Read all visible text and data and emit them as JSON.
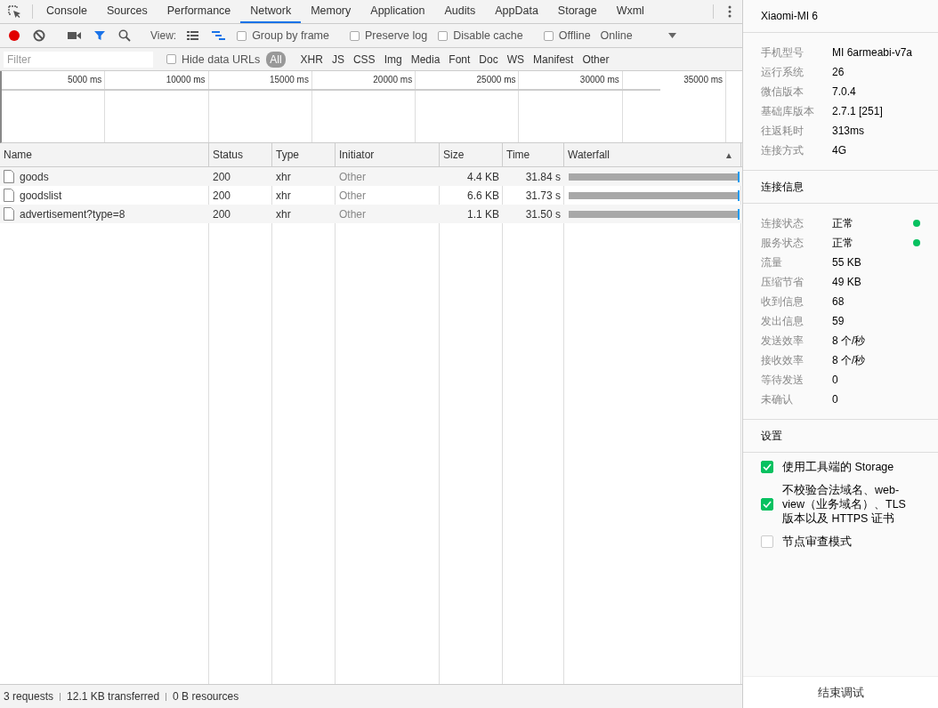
{
  "tabs": [
    {
      "label": "Console",
      "selected": false
    },
    {
      "label": "Sources",
      "selected": false
    },
    {
      "label": "Performance",
      "selected": false
    },
    {
      "label": "Network",
      "selected": true
    },
    {
      "label": "Memory",
      "selected": false
    },
    {
      "label": "Application",
      "selected": false
    },
    {
      "label": "Audits",
      "selected": false
    },
    {
      "label": "AppData",
      "selected": false
    },
    {
      "label": "Storage",
      "selected": false
    },
    {
      "label": "Wxml",
      "selected": false
    }
  ],
  "toolbar": {
    "recording": true,
    "filter_active": true,
    "view_label": "View:",
    "views": [
      {
        "kind": "list",
        "selected": false
      },
      {
        "kind": "waterfall",
        "selected": true
      }
    ],
    "options": [
      {
        "label": "Group by frame",
        "checked": false
      },
      {
        "label": "Preserve log",
        "checked": false
      },
      {
        "label": "Disable cache",
        "checked": false
      },
      {
        "label": "Offline",
        "checked": false
      }
    ],
    "throttling": "Online"
  },
  "filter_bar": {
    "placeholder": "Filter",
    "hide_data_urls": {
      "label": "Hide data URLs",
      "checked": false
    },
    "types": [
      {
        "label": "All",
        "selected": true
      },
      {
        "label": "XHR",
        "selected": false
      },
      {
        "label": "JS",
        "selected": false
      },
      {
        "label": "CSS",
        "selected": false
      },
      {
        "label": "Img",
        "selected": false
      },
      {
        "label": "Media",
        "selected": false
      },
      {
        "label": "Font",
        "selected": false
      },
      {
        "label": "Doc",
        "selected": false
      },
      {
        "label": "WS",
        "selected": false
      },
      {
        "label": "Manifest",
        "selected": false
      },
      {
        "label": "Other",
        "selected": false
      }
    ]
  },
  "overview": {
    "ticks": [
      "5000 ms",
      "10000 ms",
      "15000 ms",
      "20000 ms",
      "25000 ms",
      "30000 ms",
      "35000 ms"
    ]
  },
  "table": {
    "columns": [
      {
        "label": "Name"
      },
      {
        "label": "Status"
      },
      {
        "label": "Type"
      },
      {
        "label": "Initiator"
      },
      {
        "label": "Size"
      },
      {
        "label": "Time"
      },
      {
        "label": "Waterfall",
        "sort_icon": "▲"
      }
    ],
    "rows": [
      {
        "name": "goods",
        "status": "200",
        "type": "xhr",
        "initiator": "Other",
        "size": "4.4 KB",
        "time": "31.84 s"
      },
      {
        "name": "goodslist",
        "status": "200",
        "type": "xhr",
        "initiator": "Other",
        "size": "6.6 KB",
        "time": "31.73 s"
      },
      {
        "name": "advertisement?type=8",
        "status": "200",
        "type": "xhr",
        "initiator": "Other",
        "size": "1.1 KB",
        "time": "31.50 s"
      }
    ]
  },
  "status_bar": [
    "3 requests",
    "12.1 KB transferred",
    "0 B resources"
  ],
  "device": {
    "title": "Xiaomi-MI 6",
    "info": [
      {
        "label": "手机型号",
        "value": "MI 6armeabi-v7a"
      },
      {
        "label": "运行系统",
        "value": "26"
      },
      {
        "label": "微信版本",
        "value": "7.0.4"
      },
      {
        "label": "基础库版本",
        "value": "2.7.1 [251]"
      },
      {
        "label": "往返耗时",
        "value": "313ms"
      },
      {
        "label": "连接方式",
        "value": "4G"
      }
    ]
  },
  "connection": {
    "title": "连接信息",
    "items": [
      {
        "label": "连接状态",
        "value": "正常",
        "color": "#07c160"
      },
      {
        "label": "服务状态",
        "value": "正常",
        "color": "#07c160"
      },
      {
        "label": "流量",
        "value": "55 KB"
      },
      {
        "label": "压缩节省",
        "value": "49 KB"
      },
      {
        "label": "收到信息",
        "value": "68"
      },
      {
        "label": "发出信息",
        "value": "59"
      },
      {
        "label": "发送效率",
        "value": "8 个/秒"
      },
      {
        "label": "接收效率",
        "value": "8 个/秒"
      },
      {
        "label": "等待发送",
        "value": "0"
      },
      {
        "label": "未确认",
        "value": "0"
      }
    ]
  },
  "settings": {
    "title": "设置",
    "options": [
      {
        "label": "使用工具端的 Storage",
        "checked": true
      },
      {
        "label": "不校验合法域名、web-view（业务域名）、TLS 版本以及 HTTPS 证书",
        "checked": true
      },
      {
        "label": "节点审查模式",
        "checked": false
      }
    ]
  },
  "end_button": "结束调试"
}
